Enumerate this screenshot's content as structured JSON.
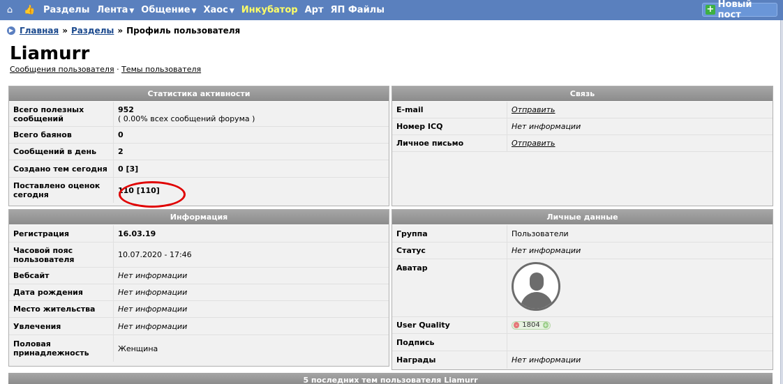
{
  "nav": {
    "items": [
      {
        "label": "Разделы",
        "caret": false,
        "highlight": false
      },
      {
        "label": "Лента",
        "caret": true,
        "highlight": false
      },
      {
        "label": "Общение",
        "caret": true,
        "highlight": false
      },
      {
        "label": "Хаос",
        "caret": true,
        "highlight": false
      },
      {
        "label": "Инкубатор",
        "caret": false,
        "highlight": true
      },
      {
        "label": "Арт",
        "caret": false,
        "highlight": false
      },
      {
        "label": "ЯП Файлы",
        "caret": false,
        "highlight": false
      }
    ],
    "new_post": "Новый пост",
    "icons": [
      "home-icon",
      "thumbs-up-icon",
      "plus-icon"
    ],
    "bg_color": "#5a80be",
    "highlight_color": "#ffff66"
  },
  "breadcrumb": {
    "home": "Главная",
    "sections": "Разделы",
    "current": "Профиль пользователя",
    "sep": "»"
  },
  "user": {
    "name": "Liamurr",
    "messages_link": "Сообщения пользователя",
    "topics_link": "Темы пользователя",
    "link_sep": "·"
  },
  "stats": {
    "title": "Статистика активности",
    "rows": [
      {
        "label": "Всего полезных сообщений",
        "value": "952",
        "sub": "( 0.00% всех сообщений форума )"
      },
      {
        "label": "Всего баянов",
        "value": "0"
      },
      {
        "label": "Сообщений в день",
        "value": "2"
      },
      {
        "label": "Создано тем сегодня",
        "value": "0 [3]"
      },
      {
        "label": "Поставлено оценок сегодня",
        "value": "110 [110]"
      }
    ]
  },
  "contact": {
    "title": "Связь",
    "rows": [
      {
        "label": "E-mail",
        "value": "Отправить"
      },
      {
        "label": "Номер ICQ",
        "value": "Нет информации"
      },
      {
        "label": "Личное письмо",
        "value": "Отправить"
      }
    ]
  },
  "info": {
    "title": "Информация",
    "rows": [
      {
        "label": "Регистрация",
        "value": "16.03.19"
      },
      {
        "label": "Часовой пояс пользователя",
        "value": "10.07.2020 - 17:46"
      },
      {
        "label": "Вебсайт",
        "value": "Нет информации"
      },
      {
        "label": "Дата рождения",
        "value": "Нет информации"
      },
      {
        "label": "Место жительства",
        "value": "Нет информации"
      },
      {
        "label": "Увлечения",
        "value": "Нет информации"
      },
      {
        "label": "Половая принадлежность",
        "value": "Женщина"
      }
    ]
  },
  "personal": {
    "title": "Личные данные",
    "rows": [
      {
        "label": "Группа",
        "value": "Пользователи"
      },
      {
        "label": "Статус",
        "value": "Нет информации"
      },
      {
        "label": "Аватар",
        "value": ""
      },
      {
        "label": "User Quality",
        "value": "1804"
      },
      {
        "label": "Подпись",
        "value": ""
      },
      {
        "label": "Награды",
        "value": "Нет информации"
      }
    ],
    "uq_minus": "-",
    "uq_plus": "+"
  },
  "footer": {
    "title": "5 последних тем пользователя Liamurr"
  }
}
